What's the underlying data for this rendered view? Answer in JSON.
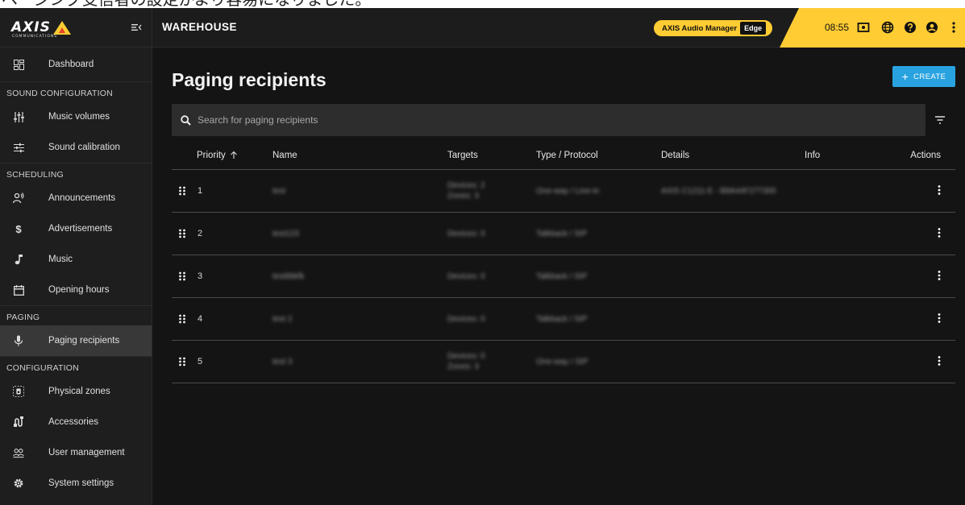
{
  "caption": "ページング受信者の設定がより容易になりました。",
  "brand": {
    "logo_text": "AXIS",
    "logo_subtext": "COMMUNICATIONS"
  },
  "header": {
    "site_name": "WAREHOUSE",
    "product_name": "AXIS Audio Manager",
    "product_edition": "Edge",
    "time": "08:55",
    "accent_color": "#ffcc33"
  },
  "sidebar": {
    "dashboard": "Dashboard",
    "sections": {
      "sound": "SOUND CONFIGURATION",
      "scheduling": "SCHEDULING",
      "paging": "PAGING",
      "configuration": "CONFIGURATION"
    },
    "items": {
      "music_volumes": "Music volumes",
      "sound_calibration": "Sound calibration",
      "announcements": "Announcements",
      "advertisements": "Advertisements",
      "music": "Music",
      "opening_hours": "Opening hours",
      "paging_recipients": "Paging recipients",
      "physical_zones": "Physical zones",
      "accessories": "Accessories",
      "user_management": "User management",
      "system_settings": "System settings"
    }
  },
  "main": {
    "title": "Paging recipients",
    "create_label": "CREATE",
    "search_placeholder": "Search for paging recipients",
    "columns": {
      "priority": "Priority",
      "name": "Name",
      "targets": "Targets",
      "type": "Type / Protocol",
      "details": "Details",
      "info": "Info",
      "actions": "Actions"
    },
    "rows": [
      {
        "priority": "1",
        "name": "test",
        "targets_1": "Devices: 2",
        "targets_2": "Zones: 3",
        "type": "One-way / Line-in",
        "details": "AXIS C1211-E - B8A44F277300"
      },
      {
        "priority": "2",
        "name": "test123",
        "targets_1": "Devices: 0",
        "targets_2": "",
        "type": "Talkback / SIP",
        "details": ""
      },
      {
        "priority": "3",
        "name": "testitbkfk",
        "targets_1": "Devices: 0",
        "targets_2": "",
        "type": "Talkback / SIP",
        "details": ""
      },
      {
        "priority": "4",
        "name": "test 2",
        "targets_1": "Devices: 0",
        "targets_2": "",
        "type": "Talkback / SIP",
        "details": ""
      },
      {
        "priority": "5",
        "name": "test 3",
        "targets_1": "Devices: 0",
        "targets_2": "Zones: 3",
        "type": "One-way / SIP",
        "details": ""
      }
    ]
  },
  "colors": {
    "primary_button": "#29a3e0",
    "background": "#141414",
    "sidebar": "#1e1e1e"
  }
}
